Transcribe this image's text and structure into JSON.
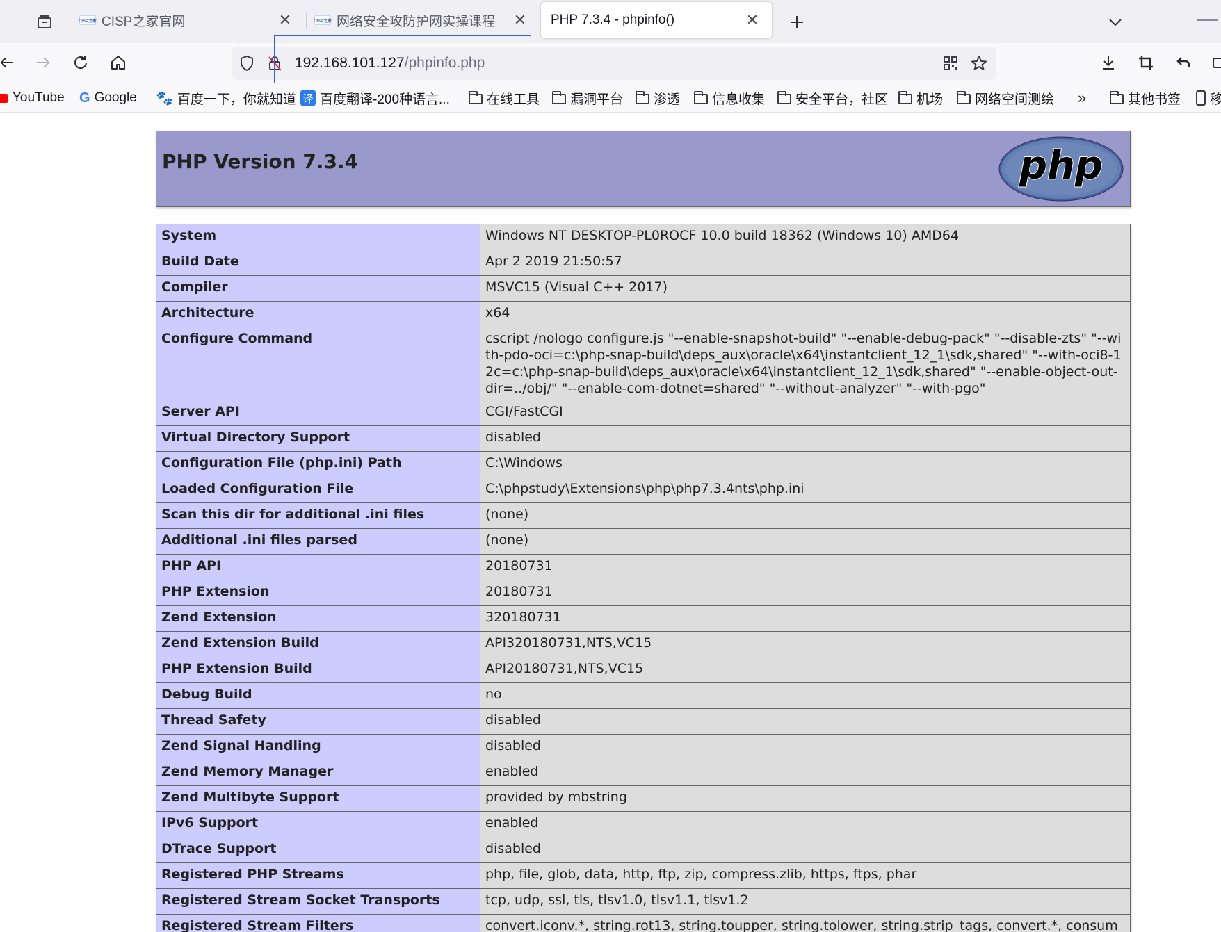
{
  "browser": {
    "tabs": [
      {
        "title": "CISP之家官网",
        "favicon": "CISP之家",
        "active": false
      },
      {
        "title": "网络安全攻防护网实操课程",
        "favicon": "CISP之家",
        "active": false
      },
      {
        "title": "PHP 7.3.4 - phpinfo()",
        "active": true
      }
    ],
    "address": {
      "host": "192.168.101.127",
      "path": "/phpinfo.php"
    },
    "bookmarks": [
      {
        "label": "YouTube",
        "icon": "youtube-icon"
      },
      {
        "label": "Google",
        "icon": "google-icon"
      },
      {
        "label": "百度一下，你就知道",
        "icon": "baidu-icon"
      },
      {
        "label": "百度翻译-200种语言...",
        "icon": "fanyi-icon"
      },
      {
        "label": "在线工具",
        "icon": "folder-icon"
      },
      {
        "label": "漏洞平台",
        "icon": "folder-icon"
      },
      {
        "label": "渗透",
        "icon": "folder-icon"
      },
      {
        "label": "信息收集",
        "icon": "folder-icon"
      },
      {
        "label": "安全平台，社区",
        "icon": "folder-icon"
      },
      {
        "label": "机场",
        "icon": "folder-icon"
      },
      {
        "label": "网络空间测绘",
        "icon": "folder-icon"
      }
    ],
    "other_bookmarks": "其他书签",
    "mobile_bookmarks": "移",
    "fanyi_glyph": "译",
    "google_glyph": "G"
  },
  "phpinfo": {
    "title": "PHP Version 7.3.4",
    "logo_text": "php",
    "rows": [
      {
        "key": "System",
        "value": "Windows NT DESKTOP-PL0ROCF 10.0 build 18362 (Windows 10) AMD64"
      },
      {
        "key": "Build Date",
        "value": "Apr 2 2019 21:50:57"
      },
      {
        "key": "Compiler",
        "value": "MSVC15 (Visual C++ 2017)"
      },
      {
        "key": "Architecture",
        "value": "x64"
      },
      {
        "key": "Configure Command",
        "value": "cscript /nologo configure.js \"--enable-snapshot-build\" \"--enable-debug-pack\" \"--disable-zts\" \"--with-pdo-oci=c:\\php-snap-build\\deps_aux\\oracle\\x64\\instantclient_12_1\\sdk,shared\" \"--with-oci8-12c=c:\\php-snap-build\\deps_aux\\oracle\\x64\\instantclient_12_1\\sdk,shared\" \"--enable-object-out-dir=../obj/\" \"--enable-com-dotnet=shared\" \"--without-analyzer\" \"--with-pgo\""
      },
      {
        "key": "Server API",
        "value": "CGI/FastCGI"
      },
      {
        "key": "Virtual Directory Support",
        "value": "disabled"
      },
      {
        "key": "Configuration File (php.ini) Path",
        "value": "C:\\Windows"
      },
      {
        "key": "Loaded Configuration File",
        "value": "C:\\phpstudy\\Extensions\\php\\php7.3.4nts\\php.ini"
      },
      {
        "key": "Scan this dir for additional .ini files",
        "value": "(none)"
      },
      {
        "key": "Additional .ini files parsed",
        "value": "(none)"
      },
      {
        "key": "PHP API",
        "value": "20180731"
      },
      {
        "key": "PHP Extension",
        "value": "20180731"
      },
      {
        "key": "Zend Extension",
        "value": "320180731"
      },
      {
        "key": "Zend Extension Build",
        "value": "API320180731,NTS,VC15"
      },
      {
        "key": "PHP Extension Build",
        "value": "API20180731,NTS,VC15"
      },
      {
        "key": "Debug Build",
        "value": "no"
      },
      {
        "key": "Thread Safety",
        "value": "disabled"
      },
      {
        "key": "Zend Signal Handling",
        "value": "disabled"
      },
      {
        "key": "Zend Memory Manager",
        "value": "enabled"
      },
      {
        "key": "Zend Multibyte Support",
        "value": "provided by mbstring"
      },
      {
        "key": "IPv6 Support",
        "value": "enabled"
      },
      {
        "key": "DTrace Support",
        "value": "disabled"
      },
      {
        "key": "Registered PHP Streams",
        "value": "php, file, glob, data, http, ftp, zip, compress.zlib, https, ftps, phar"
      },
      {
        "key": "Registered Stream Socket Transports",
        "value": "tcp, udp, ssl, tls, tlsv1.0, tlsv1.1, tlsv1.2"
      },
      {
        "key": "Registered Stream Filters",
        "value": "convert.iconv.*, string.rot13, string.toupper, string.tolower, string.strip_tags, convert.*, consumed, dechunk"
      }
    ]
  },
  "colors": {
    "header_bg": "#9999cc",
    "key_bg": "#ccccff",
    "value_bg": "#dddddd",
    "logo_bg": "#6181b6"
  }
}
